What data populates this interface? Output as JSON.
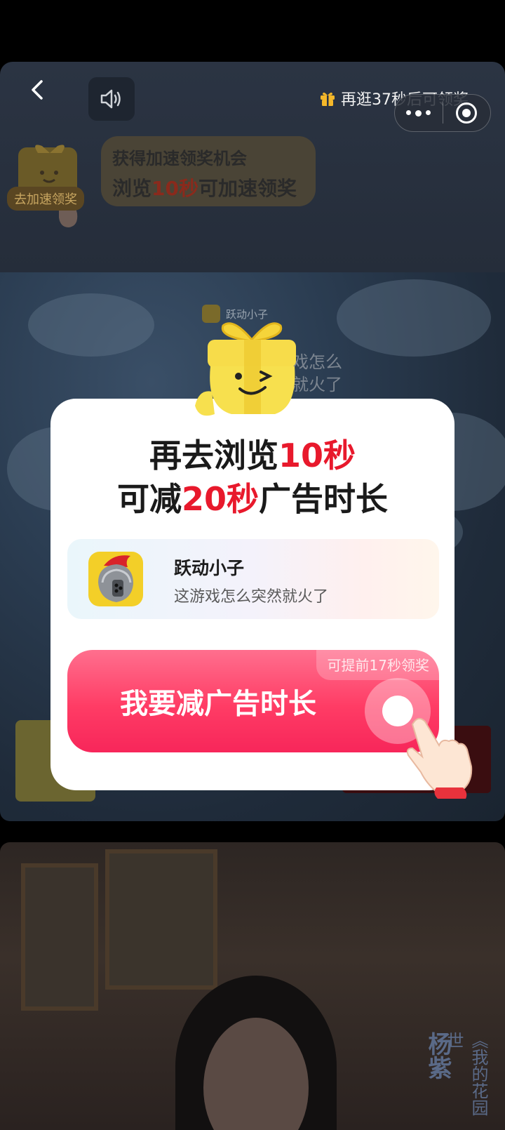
{
  "header": {
    "back_icon": "chevron-left-icon",
    "sound_icon": "speaker-icon",
    "timer_text": "再逛37秒后可领奖",
    "more_icon": "more-dots-icon",
    "close_icon": "target-circle-icon"
  },
  "speed_bonus": {
    "badge_label": "去加速领奖",
    "tip_line1": "获得加速领奖机会",
    "tip_line2_pre": "浏览",
    "tip_line2_hl": "10秒",
    "tip_line2_post": "可加速领奖"
  },
  "background_ad": {
    "app_name": "跃动小子",
    "desc_line1": "戏怎么",
    "desc_line2": "就火了"
  },
  "background_photo": {
    "vertical_title": "杨紫",
    "vertical_sub": "《我的花园世"
  },
  "modal": {
    "title_line1_pre": "再去浏览",
    "title_line1_hl": "10秒",
    "title_line2_pre": "可减",
    "title_line2_hl": "20秒",
    "title_line2_post": "广告时长",
    "app_name": "跃动小子",
    "app_desc": "这游戏怎么突然就火了",
    "cta_badge": "可提前17秒领奖",
    "cta_label": "我要减广告时长"
  },
  "colors": {
    "accent_red": "#e8192c",
    "cta_pink": "#ff3c65",
    "gift_yellow": "#f5d43a"
  }
}
